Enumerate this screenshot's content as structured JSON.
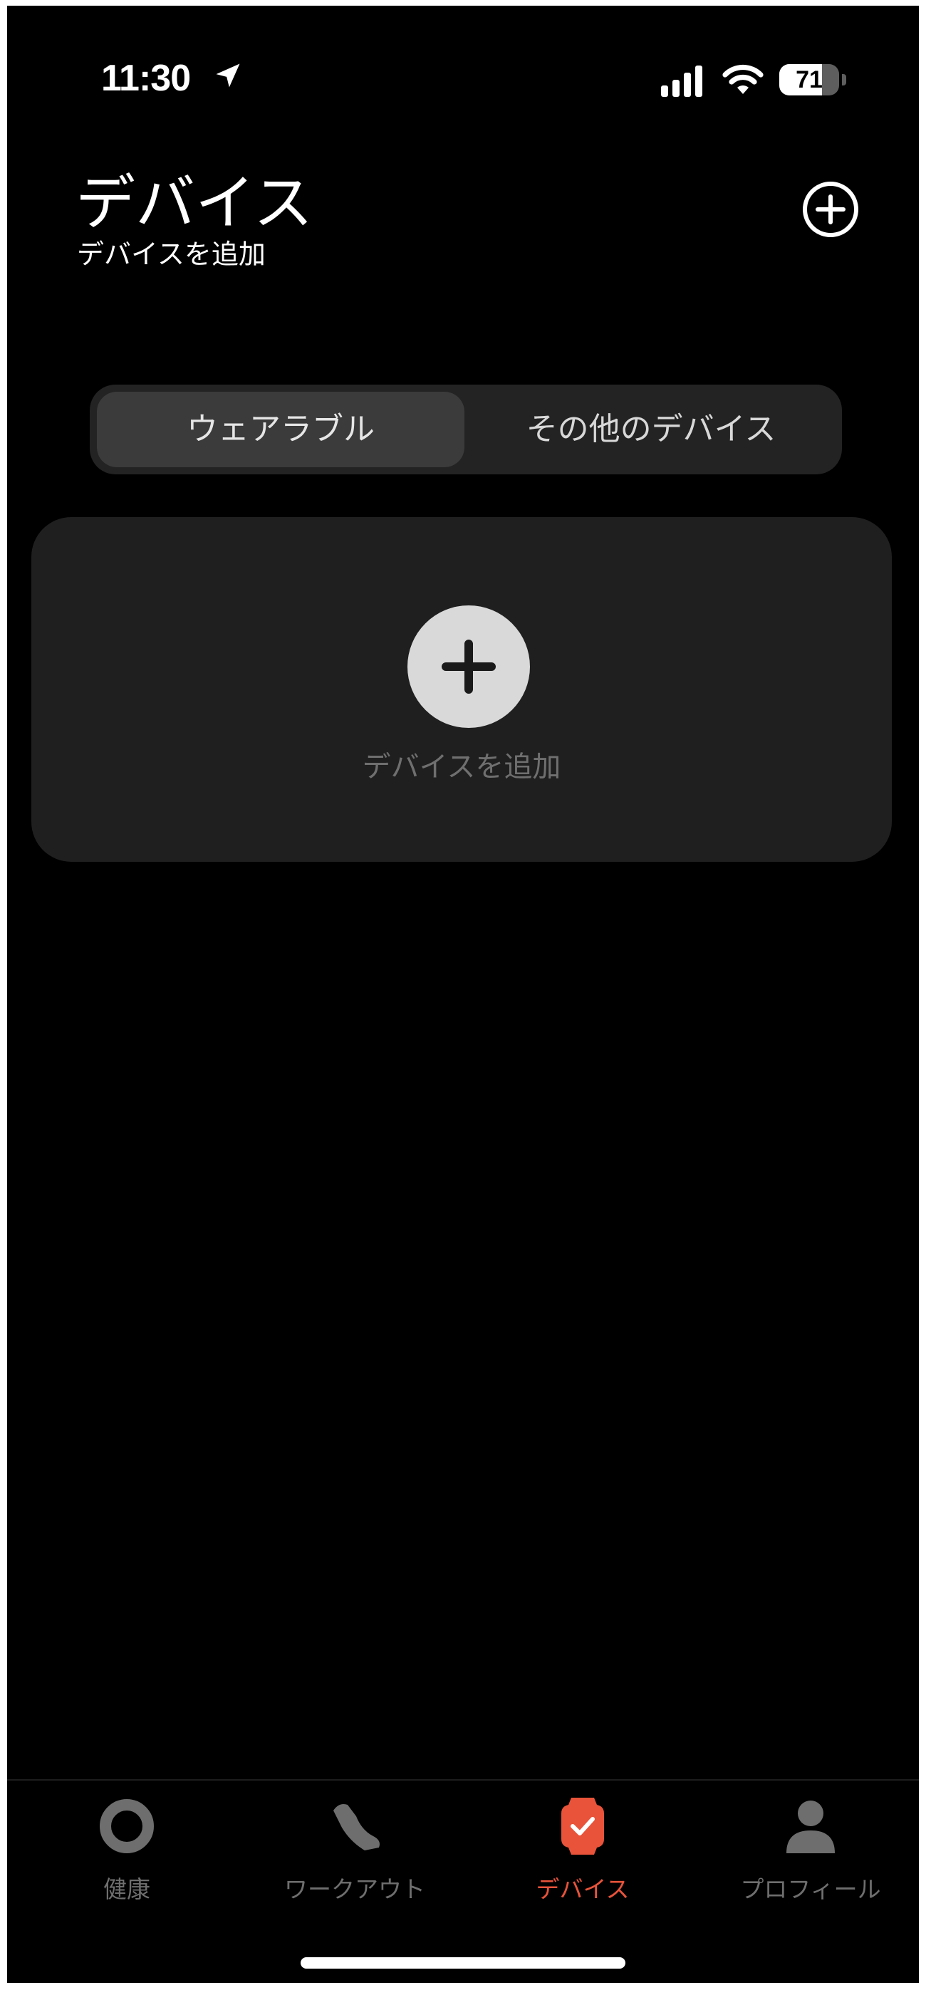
{
  "status_bar": {
    "time": "11:30",
    "battery_level": "71",
    "battery_fraction": 0.71,
    "icons": [
      "location-arrow-icon",
      "cellular-signal-icon",
      "wifi-icon",
      "battery-icon"
    ]
  },
  "header": {
    "title": "デバイス",
    "subtitle": "デバイスを追加",
    "add_icon": "plus-circle-icon"
  },
  "segmented_control": {
    "tabs": [
      {
        "label": "ウェアラブル",
        "selected": true
      },
      {
        "label": "その他のデバイス",
        "selected": false
      }
    ]
  },
  "add_device_card": {
    "icon": "plus-icon",
    "label": "デバイスを追加"
  },
  "tab_bar": {
    "items": [
      {
        "label": "健康",
        "icon": "ring-icon",
        "active": false
      },
      {
        "label": "ワークアウト",
        "icon": "shoe-icon",
        "active": false
      },
      {
        "label": "デバイス",
        "icon": "watch-icon",
        "active": true
      },
      {
        "label": "プロフィール",
        "icon": "person-icon",
        "active": false
      }
    ]
  },
  "colors": {
    "background": "#000000",
    "card": "#1f1f1f",
    "accent": "#e8533a",
    "inactive": "#6e6e6e"
  }
}
